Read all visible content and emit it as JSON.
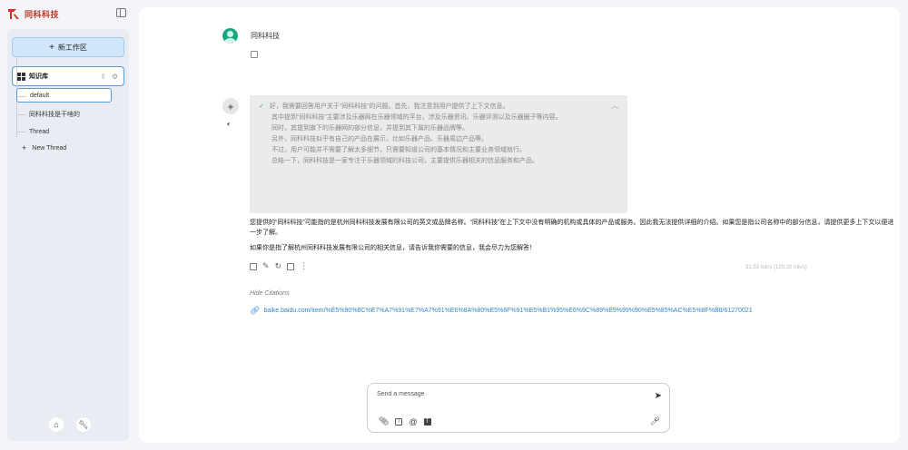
{
  "brand": {
    "name": "同科科技",
    "logo_color": "#c0392b"
  },
  "sidebar": {
    "new_workspace_label": "新工作区",
    "knowledge_base_label": "知识库",
    "threads": [
      {
        "label": "default",
        "active": true
      },
      {
        "label": "同科科技是干啥的",
        "active": false
      },
      {
        "label": "Thread",
        "active": false
      }
    ],
    "new_thread_label": "New Thread"
  },
  "chat": {
    "user_name": "同科科技",
    "thinking": {
      "lines": [
        "好，我需要回答用户关于“同科科技”的问题。首先，我注意到用户提供了上下文信息。",
        "其中提到“同科科技”主要涉及乐器网在乐器领域的平台，涉及乐器资讯、乐器评测以及乐器圈子等内容。",
        "同时，其提到旗下的乐器网的部分信息，并提到其下属的乐器品牌等。",
        "另外，同科科技似乎有自己的产品在展示，比如乐器产品、乐器周边产品等。",
        "不过，用户可能并不需要了解太多细节，只需要知道公司的基本情况和主要业务领域就行。",
        "总结一下，同科科技是一家专注于乐器领域的科技公司，主要提供乐器相关的信息服务和产品。"
      ]
    },
    "answer": [
      "您提供的“同科科技”可能指的是杭州同科科技发展有限公司的英文或品牌名称。“同科科技”在上下文中没有明确的机构或具体的产品或服务。因此我无法提供详细的介绍。如果您是指公司名称中的部分信息，请提供更多上下文以便进一步了解。",
      "如果你是指了解杭州同科科技发展有限公司的相关信息，请告诉我你需要的信息，我会尽力为您解答！"
    ],
    "speed": "31.53 tok/s (120.20 tok/s)",
    "hide_citations_label": "Hide Citations",
    "citation_url": "baike.baidu.com/item/%E5%90%8C%E7%A7%91%E7%A7%91%E6%8A%80%E5%8F%91%E5%B1%95%E6%9C%89%E9%99%90%E5%85%AC%E5%8F%B8/61270021"
  },
  "composer": {
    "placeholder": "Send a message"
  }
}
